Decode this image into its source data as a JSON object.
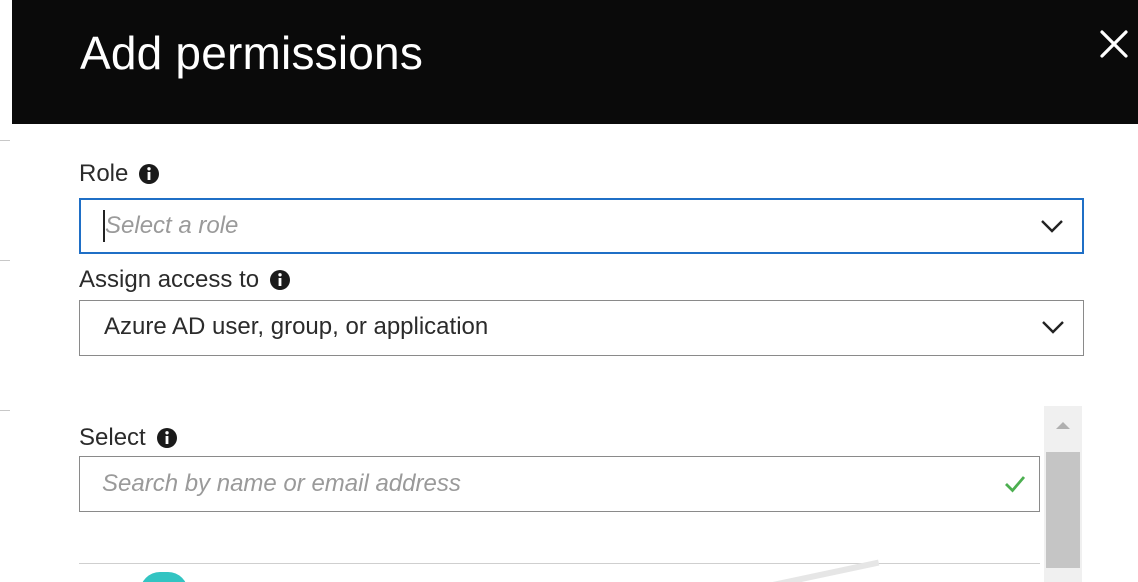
{
  "dialog": {
    "title": "Add permissions",
    "close_icon": "close-icon"
  },
  "role": {
    "label": "Role",
    "info_icon": "info-icon",
    "placeholder": "Select a role",
    "value": ""
  },
  "assign_access": {
    "label": "Assign access to",
    "info_icon": "info-icon",
    "value": "Azure AD user, group, or application"
  },
  "select": {
    "label": "Select",
    "info_icon": "info-icon",
    "placeholder": "Search by name or email address",
    "valid_icon": "checkmark-icon"
  },
  "colors": {
    "header_bg": "#0a0a0a",
    "focus_border": "#1f6fc6",
    "check_green": "#4caf50",
    "avatar_teal": "#32c4c2"
  }
}
